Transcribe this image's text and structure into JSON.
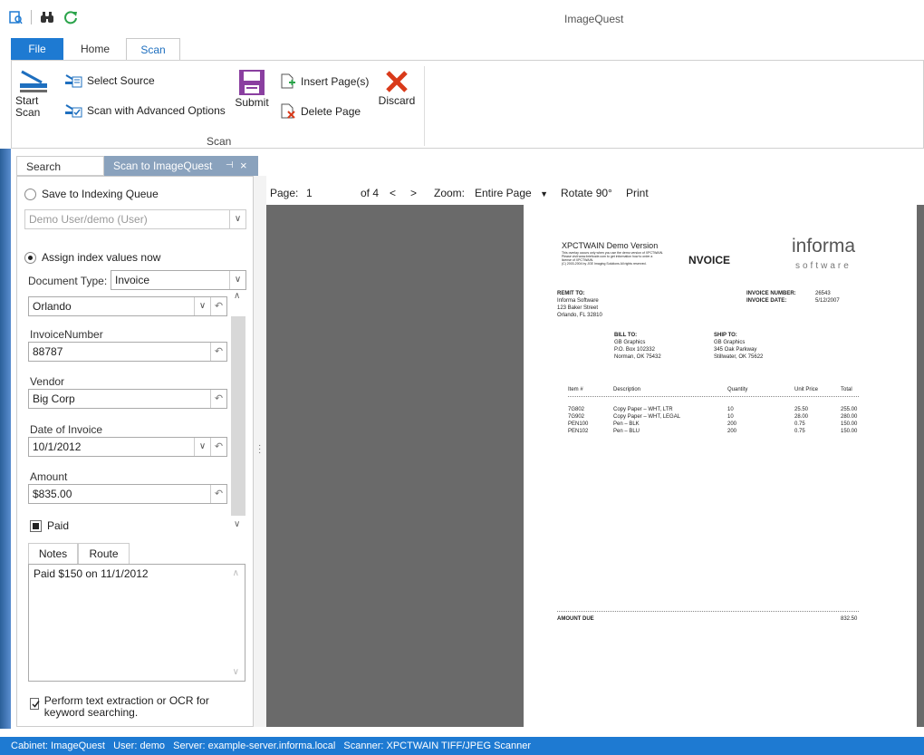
{
  "app_title": "ImageQuest",
  "ribbon_tabs": {
    "file": "File",
    "home": "Home",
    "scan": "Scan"
  },
  "ribbon": {
    "start_scan": "Start\nScan",
    "select_source": "Select Source",
    "scan_advanced": "Scan with Advanced Options",
    "submit": "Submit",
    "insert_pages": "Insert Page(s)",
    "delete_page": "Delete Page",
    "discard": "Discard",
    "group_label": "Scan"
  },
  "doc_tabs": {
    "search": "Search",
    "scan_to": "Scan to ImageQuest"
  },
  "left": {
    "save_to_queue": "Save to Indexing Queue",
    "queue_user": "Demo User/demo (User)",
    "assign_now": "Assign index values now",
    "doc_type_label": "Document Type:",
    "doc_type_value": "Invoice",
    "city_value": "Orlando",
    "fields": [
      {
        "label": "InvoiceNumber",
        "value": "88787"
      },
      {
        "label": "Vendor",
        "value": "Big Corp"
      },
      {
        "label": "Date of Invoice",
        "value": "10/1/2012"
      },
      {
        "label": "Amount",
        "value": "$835.00"
      }
    ],
    "paid_label": "Paid",
    "tab_notes": "Notes",
    "tab_route": "Route",
    "notes_text": "Paid $150 on 11/1/2012",
    "ocr_label": "Perform text extraction or OCR for keyword searching."
  },
  "viewer": {
    "page_label": "Page:",
    "page_value": "1",
    "of_label": "of 4",
    "prev": "<",
    "next": ">",
    "zoom_label": "Zoom:",
    "zoom_value": "Entire Page",
    "rotate": "Rotate 90°",
    "print": "Print"
  },
  "invoice": {
    "demo_title": "XPCTWAIN Demo Version",
    "demo_line1": "This overlay occurs only when you use the demo version of XPCTWAIN.",
    "demo_line2": "Please visit www.briefcode.com to get information how to order a",
    "demo_line3": "license of XPCTWAIN.",
    "demo_line4": "(C) 2003-2004 by JGE Imaging Solutions All rights reserved.",
    "heading": "NVOICE",
    "brand": "informa",
    "brand_sub": "software",
    "remit_label": "REMIT TO:",
    "remit_name": "Informa Software",
    "remit_street": "123 Baker Street",
    "remit_city": "Orlando, FL 32810",
    "invnum_label": "INVOICE NUMBER:",
    "invnum_value": "26543",
    "invdate_label": "INVOICE DATE:",
    "invdate_value": "5/12/2007",
    "billto_label": "BILL TO:",
    "billto_name": "GB Graphics",
    "billto_street": "P.O. Box 102332",
    "billto_city": "Norman, OK 75432",
    "shipto_label": "SHIP TO:",
    "shipto_name": "GB Graphics",
    "shipto_street": "345 Oak Parkway",
    "shipto_city": "Stillwater, OK 75622",
    "col_item": "Item #",
    "col_desc": "Description",
    "col_qty": "Quantity",
    "col_price": "Unit Price",
    "col_total": "Total",
    "rows": [
      {
        "item": "7G802",
        "desc": "Copy Paper – WHT, LTR",
        "qty": "10",
        "price": "25.50",
        "total": "255.00"
      },
      {
        "item": "7G902",
        "desc": "Copy Paper – WHT, LEGAL",
        "qty": "10",
        "price": "28.00",
        "total": "280.00"
      },
      {
        "item": "PEN100",
        "desc": "Pen – BLK",
        "qty": "200",
        "price": "0.75",
        "total": "150.00"
      },
      {
        "item": "PEN102",
        "desc": "Pen – BLU",
        "qty": "200",
        "price": "0.75",
        "total": "150.00"
      }
    ],
    "amount_due_label": "AMOUNT DUE",
    "amount_due_value": "832.50"
  },
  "status": "Cabinet: ImageQuest   User: demo   Server: example-server.informa.local   Scanner: XPCTWAIN TIFF/JPEG Scanner",
  "colors": {
    "accent": "#1e7ad2",
    "viewer_bg": "#6a6a6a",
    "discard": "#d93a1a",
    "submit": "#8a3fa0"
  }
}
